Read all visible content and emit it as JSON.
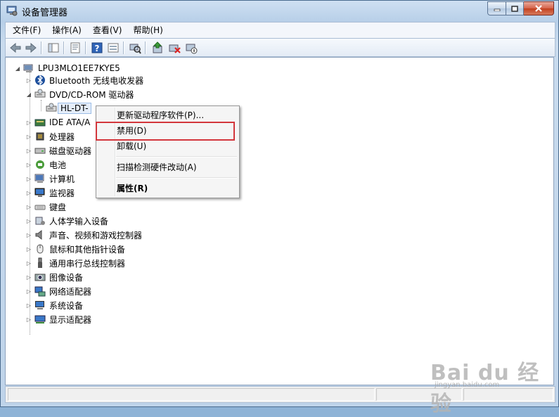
{
  "window": {
    "title": "设备管理器"
  },
  "menubar": {
    "items": [
      "文件(F)",
      "操作(A)",
      "查看(V)",
      "帮助(H)"
    ]
  },
  "toolbar": {
    "buttons": [
      "back-icon",
      "forward-icon",
      "show-hide-tree-icon",
      "properties-icon",
      "help-icon",
      "view-icon",
      "scan-hardware-icon",
      "update-driver-icon",
      "uninstall-icon",
      "disable-icon"
    ]
  },
  "tree": {
    "root": "LPU3MLO1EE7KYE5",
    "items": [
      {
        "label": "Bluetooth 无线电收发器",
        "icon": "bluetooth-icon",
        "expanded": false
      },
      {
        "label": "DVD/CD-ROM 驱动器",
        "icon": "dvd-drive-icon",
        "expanded": true
      },
      {
        "label": "HL-DT-",
        "icon": "dvd-drive-icon",
        "child": true,
        "selected": true
      },
      {
        "label": "IDE ATA/A",
        "icon": "ide-controller-icon",
        "expanded": false
      },
      {
        "label": "处理器",
        "icon": "processor-icon",
        "expanded": false
      },
      {
        "label": "磁盘驱动器",
        "icon": "disk-drive-icon",
        "expanded": false
      },
      {
        "label": "电池",
        "icon": "battery-icon",
        "expanded": false
      },
      {
        "label": "计算机",
        "icon": "computer-icon",
        "expanded": false
      },
      {
        "label": "监视器",
        "icon": "monitor-icon",
        "expanded": false
      },
      {
        "label": "键盘",
        "icon": "keyboard-icon",
        "expanded": false
      },
      {
        "label": "人体学输入设备",
        "icon": "hid-icon",
        "expanded": false
      },
      {
        "label": "声音、视频和游戏控制器",
        "icon": "speaker-icon",
        "expanded": false
      },
      {
        "label": "鼠标和其他指针设备",
        "icon": "mouse-icon",
        "expanded": false
      },
      {
        "label": "通用串行总线控制器",
        "icon": "usb-icon",
        "expanded": false
      },
      {
        "label": "图像设备",
        "icon": "camera-icon",
        "expanded": false
      },
      {
        "label": "网络适配器",
        "icon": "network-adapter-icon",
        "expanded": false
      },
      {
        "label": "系统设备",
        "icon": "system-device-icon",
        "expanded": false
      },
      {
        "label": "显示适配器",
        "icon": "display-adapter-icon",
        "expanded": false
      }
    ]
  },
  "context_menu": {
    "items": [
      {
        "label": "更新驱动程序软件(P)...",
        "bold": false
      },
      {
        "label": "禁用(D)",
        "bold": false,
        "highlighted": true
      },
      {
        "label": "卸载(U)",
        "bold": false
      },
      {
        "label": "扫描检测硬件改动(A)",
        "bold": false
      },
      {
        "label": "属性(R)",
        "bold": true
      }
    ]
  },
  "watermark": {
    "logo": "Bai du 经验",
    "url": "jingyan.baidu.com"
  },
  "colors": {
    "highlight_box": "#d3363c",
    "title_bar": "#b7cfe8",
    "close_button": "#c2401f"
  }
}
